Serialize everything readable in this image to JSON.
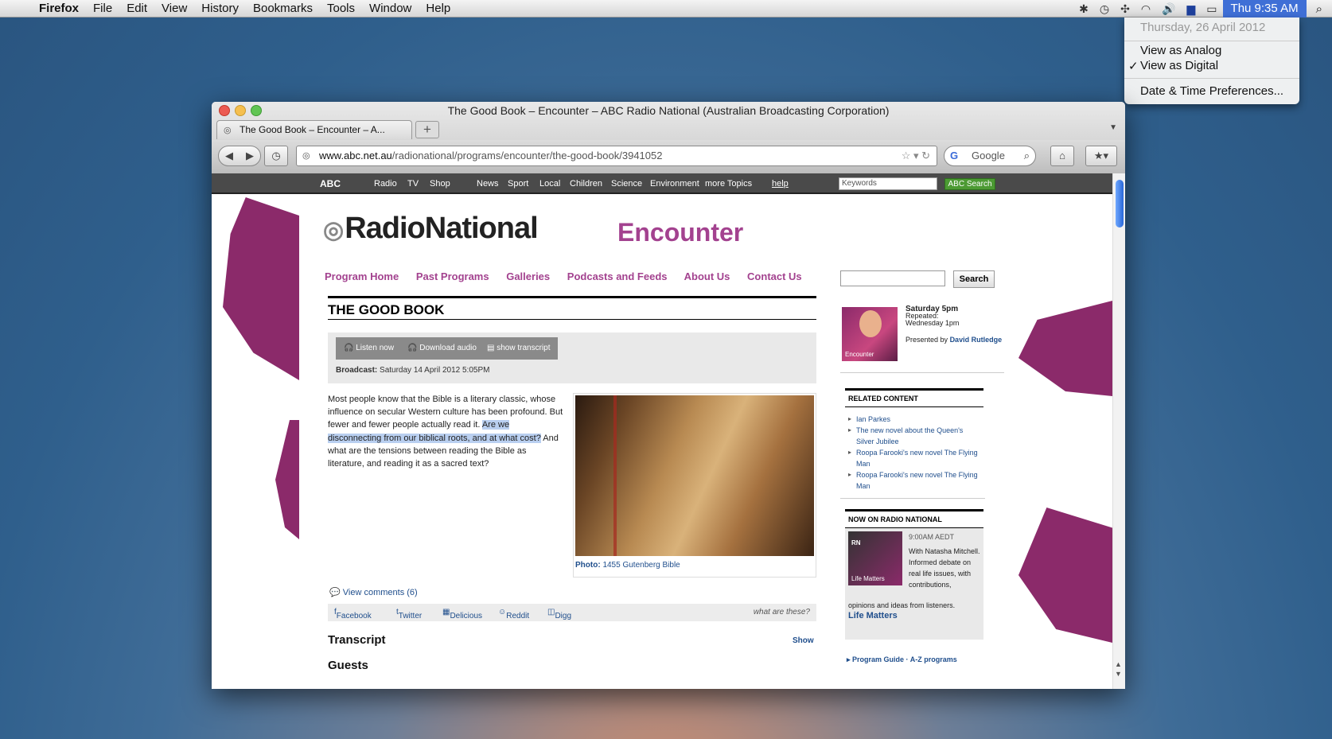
{
  "menubar": {
    "app": "Firefox",
    "items": [
      "File",
      "Edit",
      "View",
      "History",
      "Bookmarks",
      "Tools",
      "Window",
      "Help"
    ],
    "clock": "Thu 9:35 AM",
    "flag_icon": "australia-flag-icon"
  },
  "clock_menu": {
    "date": "Thursday, 26 April 2012",
    "analog": "View as Analog",
    "digital": "View as Digital",
    "prefs": "Date & Time Preferences..."
  },
  "window": {
    "title": "The Good Book – Encounter – ABC Radio National (Australian Broadcasting Corporation)",
    "tab_label": "The Good Book – Encounter – A...",
    "url_domain": "www.abc.net.au",
    "url_path": "/radionational/programs/encounter/the-good-book/3941052",
    "search_engine": "Google"
  },
  "abc_nav": {
    "logo": "ABC",
    "links": [
      "Radio",
      "TV",
      "Shop",
      "News",
      "Sport",
      "Local",
      "Children",
      "Science",
      "Environment",
      "more Topics"
    ],
    "help": "help",
    "keywords_placeholder": "Keywords",
    "search_btn": "ABC Search"
  },
  "brand": {
    "logo": "RadioNational",
    "program": "Encounter",
    "accent": "#a3428f"
  },
  "prog_nav": [
    "Program Home",
    "Past Programs",
    "Galleries",
    "Podcasts and Feeds",
    "About Us",
    "Contact Us"
  ],
  "article": {
    "title": "THE GOOD BOOK",
    "listen": "Listen now",
    "download": "Download audio",
    "show_transcript": "show transcript",
    "broadcast_label": "Broadcast:",
    "broadcast_value": "Saturday 14 April 2012 5:05PM",
    "body_1": "Most people know that the Bible is a literary classic, whose influence on secular Western culture has been profound. But fewer and fewer people actually read it. ",
    "body_hl": "Are we disconnecting from our biblical roots, and at what cost?",
    "body_2": " And what are the tensions between reading the Bible as literature, and reading it as a sacred text?",
    "photo_label": "Photo:",
    "photo_caption": "1455 Gutenberg Bible",
    "comments": "View comments (6)",
    "share": [
      "Facebook",
      "Twitter",
      "Delicious",
      "Reddit",
      "Digg"
    ],
    "what_are_these": "what are these?",
    "transcript": "Transcript",
    "show": "Show",
    "guests": "Guests"
  },
  "sidebar": {
    "search_btn": "Search",
    "presenter_img_label": "Encounter",
    "schedule_day": "Saturday 5pm",
    "repeated": "Repeated:",
    "repeat_time": "Wednesday 1pm",
    "presented_by": "Presented by",
    "presenter": "David Rutledge",
    "related_head": "RELATED CONTENT",
    "related": [
      "Ian Parkes",
      "The new novel about the Queen's Silver Jubilee",
      "Roopa Farooki's new novel The Flying Man",
      "Roopa Farooki's new novel The Flying Man"
    ],
    "now_head": "NOW ON RADIO NATIONAL",
    "now_img_label": "Life Matters",
    "now_rn": "RN",
    "now_time": "9:00AM AEDT",
    "now_desc": "With Natasha Mitchell. Informed debate on real life issues, with contributions,",
    "now_desc2": "opinions and ideas from listeners.",
    "now_name": "Life Matters",
    "program_guide": "Program Guide",
    "az": "A-Z programs"
  }
}
